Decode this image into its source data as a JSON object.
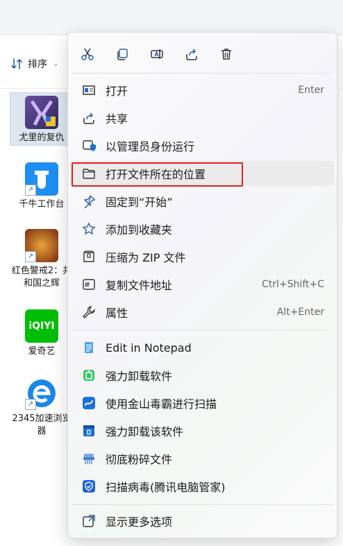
{
  "toolbar": {
    "sort_label": "排序"
  },
  "desktop_icons": [
    {
      "label": "尤里的复仇"
    },
    {
      "label": "千牛工作台"
    },
    {
      "label": "红色警戒2：共和国之辉"
    },
    {
      "label": "爱奇艺"
    },
    {
      "label": "2345加速浏览器"
    }
  ],
  "context_menu": {
    "quick_actions": [
      {
        "name": "cut",
        "icon": "scissors-icon"
      },
      {
        "name": "copy",
        "icon": "copy-icon"
      },
      {
        "name": "rename",
        "icon": "rename-icon"
      },
      {
        "name": "share",
        "icon": "share-icon"
      },
      {
        "name": "delete",
        "icon": "trash-icon"
      }
    ],
    "items": [
      {
        "label": "打开",
        "shortcut": "Enter",
        "icon": "open-window-icon"
      },
      {
        "label": "共享",
        "icon": "share-icon"
      },
      {
        "label": "以管理员身份运行",
        "icon": "admin-shield-icon"
      },
      {
        "label": "打开文件所在的位置",
        "icon": "folder-icon"
      },
      {
        "label": "固定到“开始”",
        "icon": "pin-icon"
      },
      {
        "label": "添加到收藏夹",
        "icon": "star-icon"
      },
      {
        "label": "压缩为 ZIP 文件",
        "icon": "zip-icon"
      },
      {
        "label": "复制文件地址",
        "shortcut": "Ctrl+Shift+C",
        "icon": "copy-path-icon"
      },
      {
        "label": "属性",
        "shortcut": "Alt+Enter",
        "icon": "wrench-icon"
      },
      {
        "label": "Edit in Notepad",
        "icon": "notepad-icon"
      },
      {
        "label": "强力卸载软件",
        "icon": "uninstall-icon"
      },
      {
        "label": "使用金山毒霸进行扫描",
        "icon": "duba-icon"
      },
      {
        "label": "强力卸载该软件",
        "icon": "uninstall-this-icon"
      },
      {
        "label": "彻底粉碎文件",
        "icon": "shredder-icon"
      },
      {
        "label": "扫描病毒(腾讯电脑管家)",
        "icon": "tencent-shield-icon"
      },
      {
        "label": "显示更多选项",
        "icon": "more-options-icon"
      }
    ]
  },
  "colors": {
    "highlight_border": "#e02020",
    "accent": "#1b6fd6"
  }
}
